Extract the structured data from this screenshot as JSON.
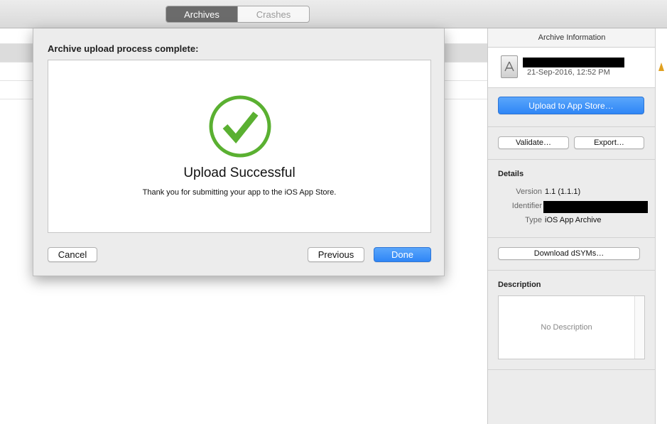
{
  "toolbar": {
    "tabs": [
      {
        "label": "Archives",
        "active": true
      },
      {
        "label": "Crashes",
        "active": false
      }
    ]
  },
  "dialog": {
    "title": "Archive upload process complete:",
    "status_icon": "checkmark-circle-icon",
    "heading": "Upload Successful",
    "message": "Thank you for submitting your app to the iOS App Store.",
    "cancel_label": "Cancel",
    "previous_label": "Previous",
    "done_label": "Done"
  },
  "inspector": {
    "title": "Archive Information",
    "archive_icon": "app-archive-icon",
    "archive_date": "21-Sep-2016, 12:52 PM",
    "upload_label": "Upload to App Store…",
    "validate_label": "Validate…",
    "export_label": "Export…",
    "details_heading": "Details",
    "version_label": "Version",
    "version_value": "1.1 (1.1.1)",
    "identifier_label": "Identifier",
    "type_label": "Type",
    "type_value": "iOS App Archive",
    "download_label": "Download dSYMs…",
    "description_heading": "Description",
    "description_placeholder": "No Description"
  },
  "colors": {
    "accent_blue": "#2f86f6",
    "success_green": "#5ab031",
    "selected_row": "#dcdcdc"
  }
}
